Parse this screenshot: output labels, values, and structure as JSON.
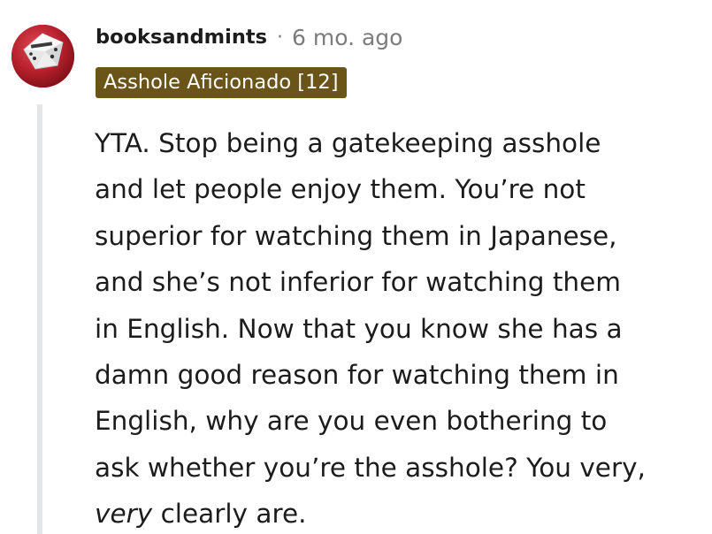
{
  "comment": {
    "author": "booksandmints",
    "separator": "·",
    "timestamp": "6 mo. ago",
    "flair": "Asshole Aficionado [12]",
    "avatar_icon": "dice-avatar-icon",
    "avatar_color": "#c0262f",
    "flair_color": "#6b5418",
    "body_lines": [
      "YTA. Stop being a gatekeeping asshole",
      "and let people enjoy them. You’re not",
      "superior for watching them in Japanese,",
      "and she’s not inferior for watching them",
      "in English. Now that you know she has a",
      "damn good reason for watching them in",
      "English, why are you even bothering to",
      "ask whether you’re the asshole? You very,"
    ],
    "last_line_emphasis": "very",
    "last_line_rest": " clearly are."
  }
}
